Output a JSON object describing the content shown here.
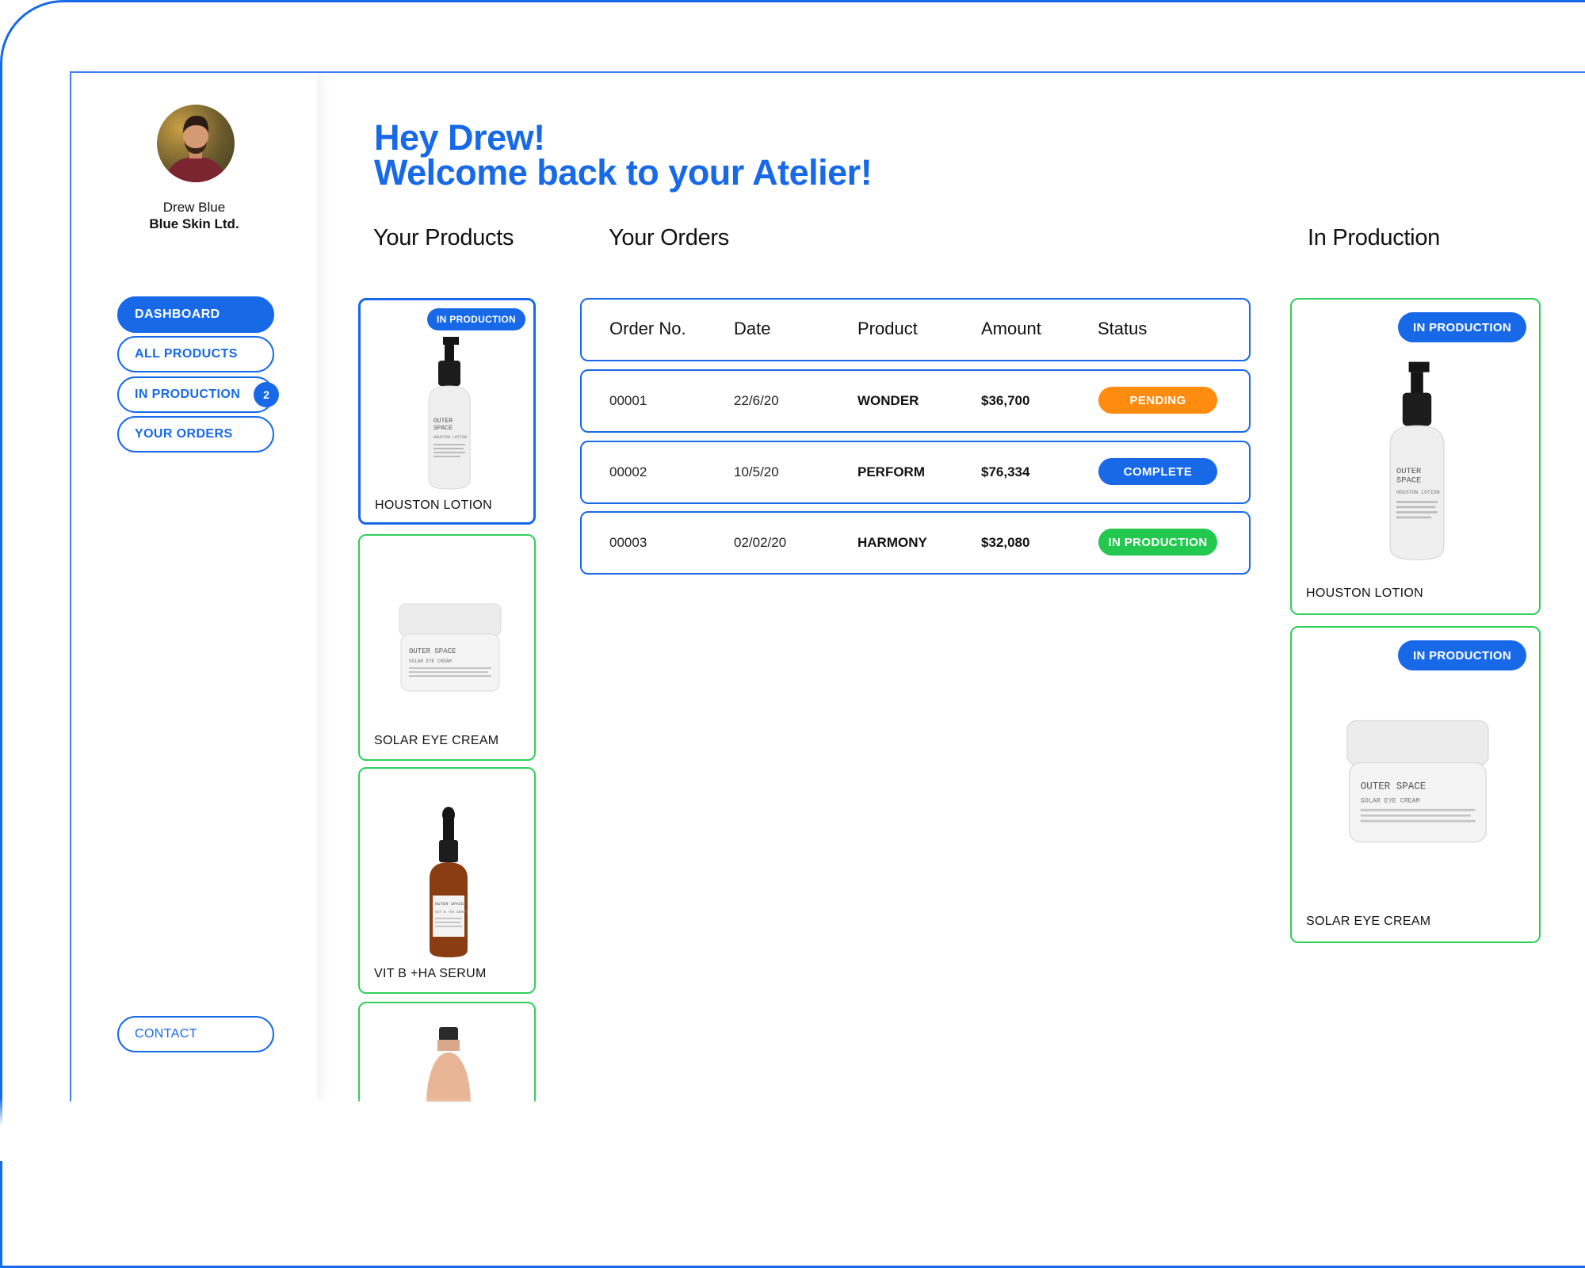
{
  "user": {
    "name": "Drew Blue",
    "company": "Blue Skin Ltd."
  },
  "nav": {
    "items": [
      {
        "label": "DASHBOARD",
        "active": true
      },
      {
        "label": "ALL PRODUCTS",
        "active": false
      },
      {
        "label": "IN PRODUCTION",
        "active": false,
        "badge": "2"
      },
      {
        "label": "YOUR ORDERS",
        "active": false
      }
    ],
    "contact": "CONTACT"
  },
  "greeting": {
    "line1": "Hey Drew!",
    "line2": "Welcome back to your Atelier!"
  },
  "sections": {
    "products": "Your Products",
    "orders": "Your Orders",
    "production": "In Production"
  },
  "products": [
    {
      "name": "HOUSTON LOTION",
      "badge": "IN PRODUCTION",
      "icon": "pump-bottle-icon",
      "bottle_text": [
        "OUTER",
        "SPACE",
        "HOUSTON LOTION"
      ]
    },
    {
      "name": "SOLAR EYE CREAM",
      "icon": "cream-jar-icon",
      "jar_text": [
        "OUTER SPACE",
        "SOLAR EYE CREAM"
      ]
    },
    {
      "name": "VIT B +HA SERUM",
      "icon": "dropper-bottle-icon",
      "bottle_text": [
        "OUTER SPACE",
        "VIT B +HA SERUM"
      ]
    }
  ],
  "orders": {
    "columns": [
      "Order No.",
      "Date",
      "Product",
      "Amount",
      "Status"
    ],
    "rows": [
      {
        "no": "00001",
        "date": "22/6/20",
        "product": "WONDER",
        "amount": "$36,700",
        "status": "PENDING",
        "color": "#ff8c0f"
      },
      {
        "no": "00002",
        "date": "10/5/20",
        "product": "PERFORM",
        "amount": "$76,334",
        "status": "COMPLETE",
        "color": "#1769e8"
      },
      {
        "no": "00003",
        "date": "02/02/20",
        "product": "HARMONY",
        "amount": "$32,080",
        "status": "IN PRODUCTION",
        "color": "#22c94e"
      }
    ]
  },
  "in_production": [
    {
      "name": "HOUSTON LOTION",
      "badge": "IN PRODUCTION",
      "icon": "pump-bottle-icon",
      "bottle_text": [
        "OUTER",
        "SPACE",
        "HOUSTON LOTION"
      ]
    },
    {
      "name": "SOLAR EYE CREAM",
      "badge": "IN PRODUCTION",
      "icon": "cream-jar-icon",
      "jar_text": [
        "OUTER SPACE",
        "SOLAR EYE CREAM"
      ]
    }
  ],
  "colors": {
    "accent": "#1769e8",
    "green": "#2fd05a",
    "orange": "#ff8c0f"
  }
}
